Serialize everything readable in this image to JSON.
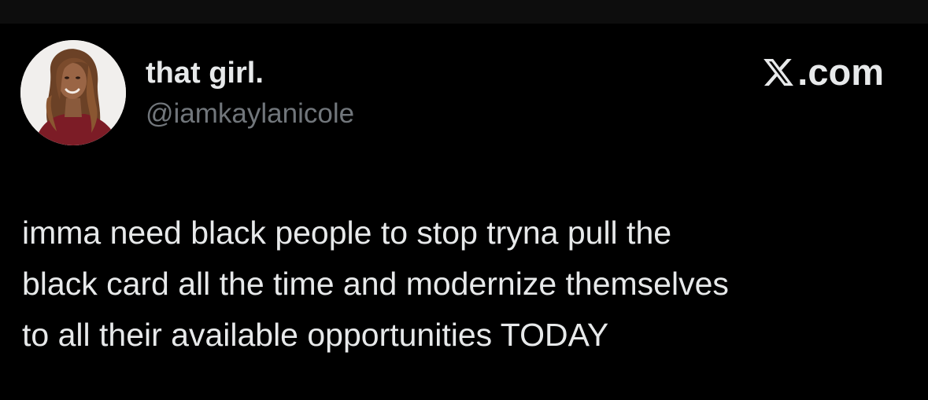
{
  "author": {
    "display_name": "that girl.",
    "handle": "@iamkaylanicole",
    "avatar_icon": "profile-photo"
  },
  "brand": {
    "icon": "x-logo-icon",
    "text": ".com"
  },
  "tweet": {
    "lines": [
      "imma need black people to stop tryna pull the",
      "black card all the time and modernize themselves",
      "to all their available opportunities TODAY"
    ]
  },
  "colors": {
    "background": "#000000",
    "text_primary": "#e7e9ea",
    "text_secondary": "#71767b"
  }
}
